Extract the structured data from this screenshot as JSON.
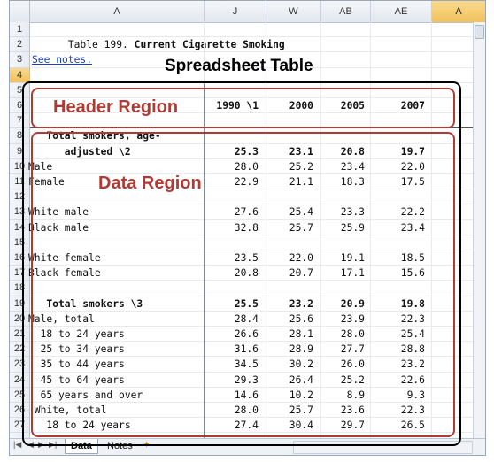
{
  "overlay": {
    "title": "Spreadsheet Table",
    "header_region": "Header Region",
    "data_region": "Data Region"
  },
  "column_headers": [
    "A",
    "J",
    "W",
    "AB",
    "AE",
    "A"
  ],
  "row_numbers": [
    "1",
    "2",
    "3",
    "4",
    "5",
    "6",
    "7",
    "8",
    "9",
    "10",
    "11",
    "12",
    "13",
    "14",
    "15",
    "16",
    "17",
    "18",
    "19",
    "20",
    "21",
    "22",
    "23",
    "24",
    "25",
    "26",
    "27"
  ],
  "cells": {
    "title_prefix": "Table 199. ",
    "title_bold": "Current Cigarette Smoking",
    "see_notes": "See notes."
  },
  "table_headers": [
    "1990 \\1",
    "2000",
    "2005",
    "2007"
  ],
  "rows": [
    {
      "label": "   Total smokers, age-",
      "bold": true,
      "values": []
    },
    {
      "label": "      adjusted \\2",
      "bold": true,
      "values": [
        "25.3",
        "23.1",
        "20.8",
        "19.7"
      ]
    },
    {
      "label": "Male",
      "bold": false,
      "values": [
        "28.0",
        "25.2",
        "23.4",
        "22.0"
      ]
    },
    {
      "label": "Female",
      "bold": false,
      "values": [
        "22.9",
        "21.1",
        "18.3",
        "17.5"
      ]
    },
    {
      "label": "",
      "bold": false,
      "values": []
    },
    {
      "label": "White male",
      "bold": false,
      "values": [
        "27.6",
        "25.4",
        "23.3",
        "22.2"
      ]
    },
    {
      "label": "Black male",
      "bold": false,
      "values": [
        "32.8",
        "25.7",
        "25.9",
        "23.4"
      ]
    },
    {
      "label": "",
      "bold": false,
      "values": []
    },
    {
      "label": "White female",
      "bold": false,
      "values": [
        "23.5",
        "22.0",
        "19.1",
        "18.5"
      ]
    },
    {
      "label": "Black female",
      "bold": false,
      "values": [
        "20.8",
        "20.7",
        "17.1",
        "15.6"
      ]
    },
    {
      "label": "",
      "bold": false,
      "values": []
    },
    {
      "label": "   Total smokers \\3",
      "bold": true,
      "values": [
        "25.5",
        "23.2",
        "20.9",
        "19.8"
      ]
    },
    {
      "label": "Male, total",
      "bold": false,
      "values": [
        "28.4",
        "25.6",
        "23.9",
        "22.3"
      ]
    },
    {
      "label": "  18 to 24 years",
      "bold": false,
      "values": [
        "26.6",
        "28.1",
        "28.0",
        "25.4"
      ]
    },
    {
      "label": "  25 to 34 years",
      "bold": false,
      "values": [
        "31.6",
        "28.9",
        "27.7",
        "28.8"
      ]
    },
    {
      "label": "  35 to 44 years",
      "bold": false,
      "values": [
        "34.5",
        "30.2",
        "26.0",
        "23.2"
      ]
    },
    {
      "label": "  45 to 64 years",
      "bold": false,
      "values": [
        "29.3",
        "26.4",
        "25.2",
        "22.6"
      ]
    },
    {
      "label": "  65 years and over",
      "bold": false,
      "values": [
        "14.6",
        "10.2",
        "8.9",
        "9.3"
      ]
    },
    {
      "label": " White, total",
      "bold": false,
      "values": [
        "28.0",
        "25.7",
        "23.6",
        "22.3"
      ]
    },
    {
      "label": "   18 to 24 years",
      "bold": false,
      "values": [
        "27.4",
        "30.4",
        "29.7",
        "26.5"
      ]
    }
  ],
  "sheet_tabs": [
    "Data",
    "Notes"
  ],
  "active_tab": "Data"
}
